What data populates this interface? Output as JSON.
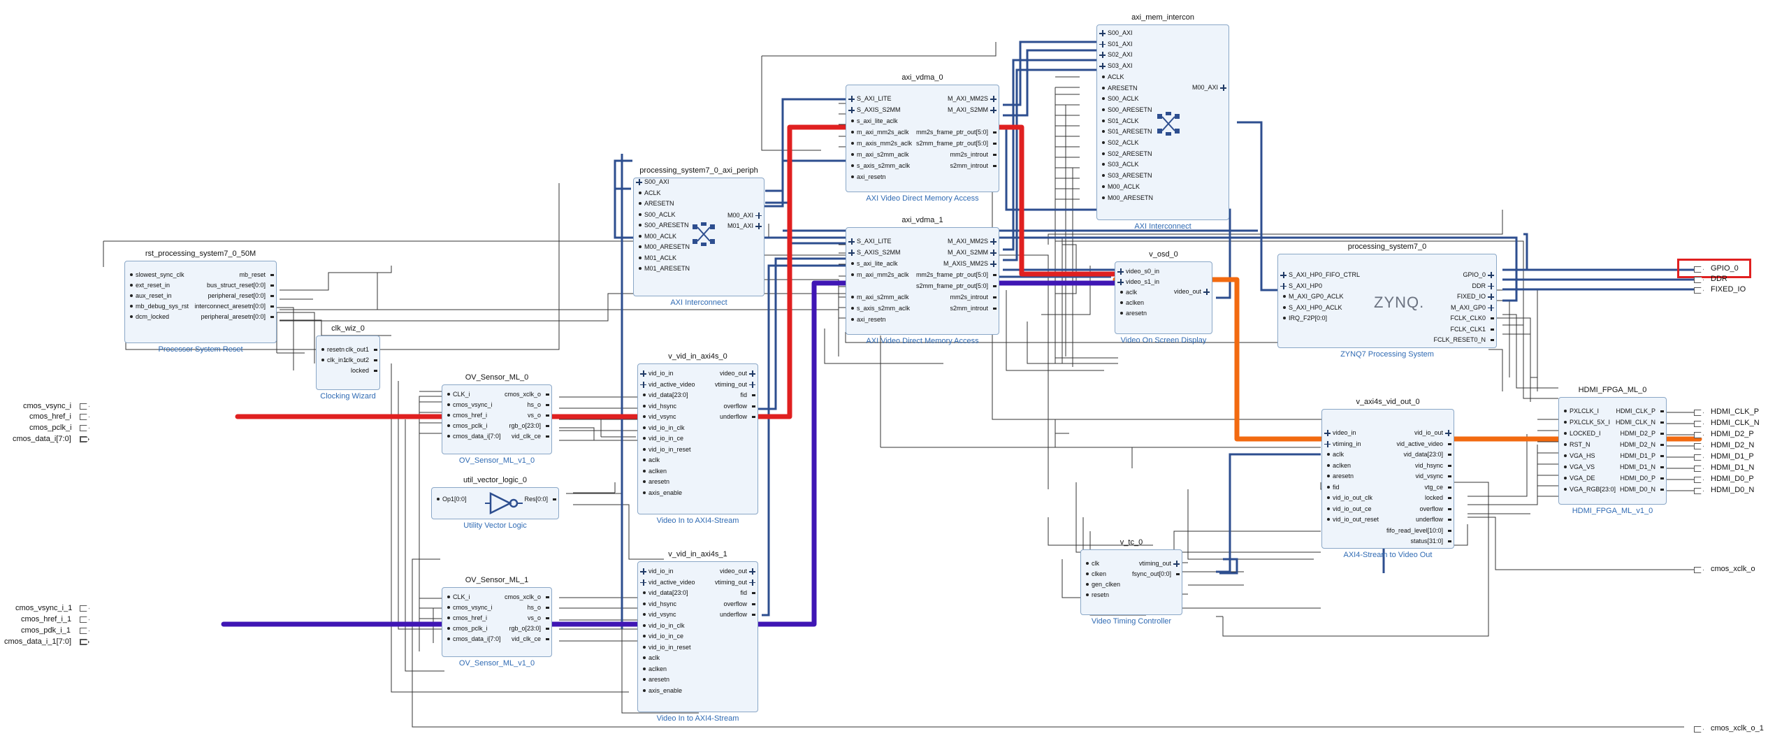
{
  "blocks": [
    {
      "id": "rst",
      "title": "rst_processing_system7_0_50M",
      "subtitle": "Processor System Reset",
      "left_pins": [
        "slowest_sync_clk",
        "ext_reset_in",
        "aux_reset_in",
        "mb_debug_sys_rst",
        "dcm_locked"
      ],
      "right_pins": [
        "mb_reset",
        "bus_struct_reset[0:0]",
        "peripheral_reset[0:0]",
        "interconnect_aresetn[0:0]",
        "peripheral_aresetn[0:0]"
      ]
    },
    {
      "id": "clk",
      "title": "clk_wiz_0",
      "subtitle": "Clocking Wizard",
      "left_pins": [
        "resetn",
        "clk_in1"
      ],
      "right_pins": [
        "clk_out1",
        "clk_out2",
        "locked"
      ]
    },
    {
      "id": "ov0",
      "title": "OV_Sensor_ML_0",
      "subtitle": "OV_Sensor_ML_v1_0",
      "left_pins": [
        "CLK_i",
        "cmos_vsync_i",
        "cmos_href_i",
        "cmos_pclk_i",
        "cmos_data_i[7:0]"
      ],
      "right_pins": [
        "cmos_xclk_o",
        "hs_o",
        "vs_o",
        "rgb_o[23:0]",
        "vid_clk_ce"
      ]
    },
    {
      "id": "ov1",
      "title": "OV_Sensor_ML_1",
      "subtitle": "OV_Sensor_ML_v1_0",
      "left_pins": [
        "CLK_i",
        "cmos_vsync_i",
        "cmos_href_i",
        "cmos_pclk_i",
        "cmos_data_i[7:0]"
      ],
      "right_pins": [
        "cmos_xclk_o",
        "hs_o",
        "vs_o",
        "rgb_o[23:0]",
        "vid_clk_ce"
      ]
    },
    {
      "id": "util",
      "title": "util_vector_logic_0",
      "subtitle": "Utility Vector Logic",
      "left_pins": [
        "Op1[0:0]"
      ],
      "right_pins": [
        "Res[0:0]"
      ]
    },
    {
      "id": "axiperiph",
      "title": "processing_system7_0_axi_periph",
      "subtitle": "AXI Interconnect",
      "left_pins": [
        "S00_AXI",
        "ACLK",
        "ARESETN",
        "S00_ACLK",
        "S00_ARESETN",
        "M00_ACLK",
        "M00_ARESETN",
        "M01_ACLK",
        "M01_ARESETN"
      ],
      "right_pins": [
        "M00_AXI",
        "M01_AXI"
      ]
    },
    {
      "id": "vin0",
      "title": "v_vid_in_axi4s_0",
      "subtitle": "Video In to AXI4-Stream",
      "left_pins": [
        "vid_io_in",
        "vid_active_video",
        "vid_data[23:0]",
        "vid_hsync",
        "vid_vsync",
        "vid_io_in_clk",
        "vid_io_in_ce",
        "vid_io_in_reset",
        "aclk",
        "aclken",
        "aresetn",
        "axis_enable"
      ],
      "right_pins": [
        "video_out",
        "vtiming_out",
        "fid",
        "overflow",
        "underflow"
      ]
    },
    {
      "id": "vin1",
      "title": "v_vid_in_axi4s_1",
      "subtitle": "Video In to AXI4-Stream",
      "left_pins": [
        "vid_io_in",
        "vid_active_video",
        "vid_data[23:0]",
        "vid_hsync",
        "vid_vsync",
        "vid_io_in_clk",
        "vid_io_in_ce",
        "vid_io_in_reset",
        "aclk",
        "aclken",
        "aresetn",
        "axis_enable"
      ],
      "right_pins": [
        "video_out",
        "vtiming_out",
        "fid",
        "overflow",
        "underflow"
      ]
    },
    {
      "id": "vdma0",
      "title": "axi_vdma_0",
      "subtitle": "AXI Video Direct Memory Access",
      "left_pins": [
        "S_AXI_LITE",
        "S_AXIS_S2MM",
        "s_axi_lite_aclk",
        "m_axi_mm2s_aclk",
        "m_axis_mm2s_aclk",
        "m_axi_s2mm_aclk",
        "s_axis_s2mm_aclk",
        "axi_resetn"
      ],
      "right_pins": [
        "M_AXI_MM2S",
        "M_AXI_S2MM",
        "",
        "mm2s_frame_ptr_out[5:0]",
        "s2mm_frame_ptr_out[5:0]",
        "mm2s_introut",
        "s2mm_introut"
      ]
    },
    {
      "id": "vdma1",
      "title": "axi_vdma_1",
      "subtitle": "AXI Video Direct Memory Access",
      "left_pins": [
        "S_AXI_LITE",
        "S_AXIS_S2MM",
        "s_axi_lite_aclk",
        "m_axi_mm2s_aclk",
        "",
        "m_axi_s2mm_aclk",
        "s_axis_s2mm_aclk",
        "axi_resetn"
      ],
      "right_pins": [
        "M_AXI_MM2S",
        "M_AXI_S2MM",
        "M_AXIS_MM2S",
        "mm2s_frame_ptr_out[5:0]",
        "s2mm_frame_ptr_out[5:0]",
        "mm2s_introut",
        "s2mm_introut"
      ]
    },
    {
      "id": "memic",
      "title": "axi_mem_intercon",
      "subtitle": "AXI Interconnect",
      "left_pins": [
        "S00_AXI",
        "S01_AXI",
        "S02_AXI",
        "S03_AXI",
        "ACLK",
        "ARESETN",
        "S00_ACLK",
        "S00_ARESETN",
        "S01_ACLK",
        "S01_ARESETN",
        "S02_ACLK",
        "S02_ARESETN",
        "S03_ACLK",
        "S03_ARESETN",
        "M00_ACLK",
        "M00_ARESETN"
      ],
      "right_pins": [
        "M00_AXI"
      ]
    },
    {
      "id": "osd",
      "title": "v_osd_0",
      "subtitle": "Video On Screen Display",
      "left_pins": [
        "video_s0_in",
        "video_s1_in",
        "aclk",
        "aclken",
        "aresetn"
      ],
      "right_pins": [
        "video_out"
      ]
    },
    {
      "id": "ps7",
      "title": "processing_system7_0",
      "subtitle": "ZYNQ7 Processing System",
      "left_pins": [
        "S_AXI_HP0_FIFO_CTRL",
        "S_AXI_HP0",
        "M_AXI_GP0_ACLK",
        "S_AXI_HP0_ACLK",
        "IRQ_F2P[0:0]"
      ],
      "right_pins": [
        "GPIO_0",
        "DDR",
        "FIXED_IO",
        "M_AXI_GP0",
        "FCLK_CLK0",
        "FCLK_CLK1",
        "FCLK_RESET0_N"
      ]
    },
    {
      "id": "vout",
      "title": "v_axi4s_vid_out_0",
      "subtitle": "AXI4-Stream to Video Out",
      "left_pins": [
        "video_in",
        "vtiming_in",
        "aclk",
        "aclken",
        "aresetn",
        "fid",
        "vid_io_out_clk",
        "vid_io_out_ce",
        "vid_io_out_reset"
      ],
      "right_pins": [
        "vid_io_out",
        "vid_active_video",
        "vid_data[23:0]",
        "vid_hsync",
        "vid_vsync",
        "vtg_ce",
        "locked",
        "overflow",
        "underflow",
        "fifo_read_level[10:0]",
        "status[31:0]"
      ]
    },
    {
      "id": "vtc",
      "title": "v_tc_0",
      "subtitle": "Video Timing Controller",
      "left_pins": [
        "clk",
        "clken",
        "gen_clken",
        "resetn"
      ],
      "right_pins": [
        "vtiming_out",
        "fsync_out[0:0]"
      ]
    },
    {
      "id": "hdmi",
      "title": "HDMI_FPGA_ML_0",
      "subtitle": "HDMI_FPGA_ML_v1_0",
      "left_pins": [
        "PXLCLK_I",
        "PXLCLK_5X_I",
        "LOCKED_I",
        "RST_N",
        "VGA_HS",
        "VGA_VS",
        "VGA_DE",
        "VGA_RGB[23:0]"
      ],
      "right_pins": [
        "HDMI_CLK_P",
        "HDMI_CLK_N",
        "HDMI_D2_P",
        "HDMI_D2_N",
        "HDMI_D1_P",
        "HDMI_D1_N",
        "HDMI_D0_P",
        "HDMI_D0_N"
      ]
    }
  ],
  "external_ports": {
    "inputs": [
      "cmos_vsync_i",
      "cmos_href_i",
      "cmos_pclk_i",
      "cmos_data_i[7:0]",
      "cmos_vsync_i_1",
      "cmos_href_i_1",
      "cmos_pdk_i_1",
      "cmos_data_i_1[7:0]"
    ],
    "outputs": [
      "GPIO_0",
      "DDR",
      "FIXED_IO",
      "HDMI_CLK_P",
      "HDMI_CLK_N",
      "HDMI_D2_P",
      "HDMI_D2_N",
      "HDMI_D1_P",
      "HDMI_D1_N",
      "HDMI_D0_P",
      "HDMI_D0_N",
      "cmos_xclk_o",
      "cmos_xclk_o_1"
    ]
  },
  "zynq_logo": "ZYNQ.",
  "colors": {
    "block_fill": "#eef4fb",
    "block_border": "#8aa7c7",
    "bus": "#2d4e8f",
    "wire": "#333333",
    "highlight_red": "#e02020",
    "highlight_orange": "#f26a10",
    "highlight_purple": "#3f16b4",
    "subtitle": "#2f6ab3"
  }
}
